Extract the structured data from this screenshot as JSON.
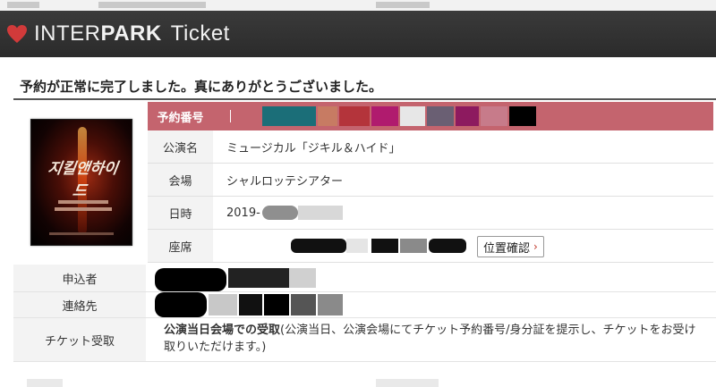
{
  "header": {
    "brand_left": "INTER",
    "brand_right": "PARK",
    "brand_product": "Ticket",
    "colors": {
      "bar": "#2f2f2f",
      "heart": "#d13a3a"
    }
  },
  "message": "予約が正常に完了しました。真にありがとうございました。",
  "reservation": {
    "number_label": "予約番号",
    "rows": [
      {
        "label": "公演名",
        "value": "ミュージカル「ジキル＆ハイド」"
      },
      {
        "label": "会場",
        "value": "シャルロッテシアター"
      },
      {
        "label": "日時",
        "value": "2019-"
      },
      {
        "label": "座席",
        "value": ""
      }
    ],
    "seat_button": "位置確認",
    "colors": {
      "number_bar": "#c4646e"
    }
  },
  "applicant": {
    "rows": [
      {
        "label": "申込者",
        "value": ""
      },
      {
        "label": "連絡先",
        "value": ""
      }
    ],
    "ticket_label": "チケット受取",
    "ticket_bold": "公演当日会場での受取",
    "ticket_detail": "(公演当日、公演会場にてチケット予約番号/身分証を提示し、チケットをお受け取りいただけます。)"
  },
  "poster": {
    "title": "지킬앤하이드"
  }
}
